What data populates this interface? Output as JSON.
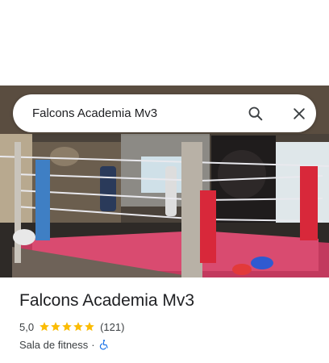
{
  "search": {
    "query": "Falcons Academia Mv3",
    "search_icon": "search-icon",
    "clear_icon": "close-icon"
  },
  "photo": {
    "description_icon": "boxing-ring-photo"
  },
  "place": {
    "name": "Falcons Academia Mv3",
    "rating": "5,0",
    "stars": 5,
    "review_count": "(121)",
    "category": "Sala de fitness",
    "separator": "·",
    "accessibility_icon": "wheelchair-accessible-icon"
  },
  "colors": {
    "star": "#fbbc04",
    "accessibility": "#1a73e8",
    "text_primary": "#202124",
    "text_secondary": "#3c4043"
  }
}
